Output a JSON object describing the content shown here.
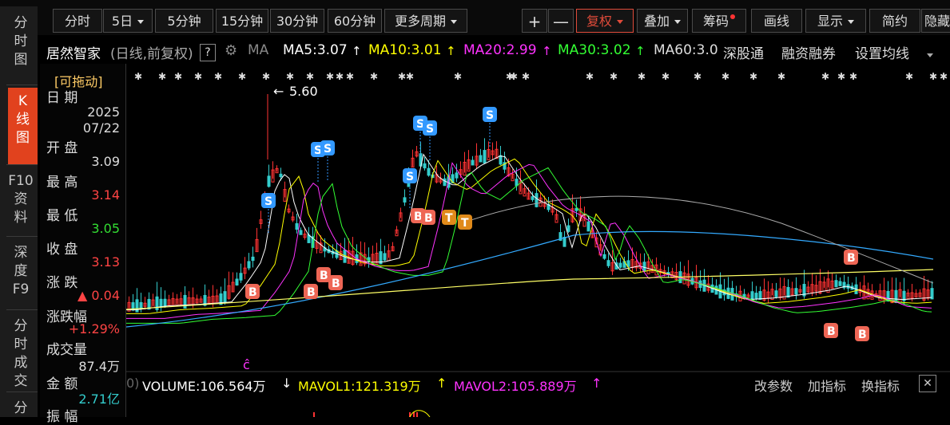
{
  "toolbar": {
    "buttons": [
      {
        "id": "fenshi",
        "label": "分时"
      },
      {
        "id": "5day",
        "label": "5日",
        "caret": true
      },
      {
        "id": "5min",
        "label": "5分钟"
      },
      {
        "id": "15min",
        "label": "15分钟"
      },
      {
        "id": "30min",
        "label": "30分钟"
      },
      {
        "id": "60min",
        "label": "60分钟"
      },
      {
        "id": "more",
        "label": "更多周期",
        "caret": true
      }
    ],
    "right_buttons": [
      {
        "id": "plus",
        "label": "+"
      },
      {
        "id": "minus",
        "label": "—"
      },
      {
        "id": "fuquan",
        "label": "复权",
        "caret": true,
        "active": true
      },
      {
        "id": "diejia",
        "label": "叠加",
        "caret": true
      },
      {
        "id": "chouma",
        "label": "筹码"
      },
      {
        "id": "huaxian",
        "label": "画线"
      },
      {
        "id": "xianshi",
        "label": "显示",
        "caret": true
      },
      {
        "id": "jianyue",
        "label": "简约"
      },
      {
        "id": "yincang",
        "label": "隐藏"
      }
    ]
  },
  "leftnav": [
    {
      "label": "分\n时\n图"
    },
    {
      "label": "K\n线\n图",
      "active": true
    },
    {
      "label": "F10\n资\n料"
    },
    {
      "label": "深\n度\nF9"
    },
    {
      "label": "分\n时\n成\n交"
    },
    {
      "label": "分"
    }
  ],
  "stock": {
    "name": "居然智家",
    "mode": "(日线,前复权)",
    "help": "?",
    "ma_label": "MA",
    "ma5": "MA5:3.07",
    "ma10": "MA10:3.01",
    "ma20": "MA20:2.99",
    "ma30": "MA30:3.02",
    "ma60": "MA60:3.0",
    "shengutong": "深股通",
    "rzrq": "融资融券",
    "setma": "设置均线"
  },
  "panel": {
    "drag": "[可拖动]",
    "date_label": "日 期",
    "year": "2025",
    "date": "07/22",
    "open_label": "开 盘",
    "open": "3.09",
    "high_label": "最 高",
    "high": "3.14",
    "low_label": "最 低",
    "low": "3.05",
    "close_label": "收 盘",
    "close": "3.13",
    "chg_label": "涨 跌",
    "chg": "▲ 0.04",
    "pct_label": "涨跌幅",
    "pct": "+1.29%",
    "vol_label": "成交量",
    "vol": "87.4万",
    "amt_label": "金 额",
    "amt": "2.71亿",
    "amp_label": "振 幅"
  },
  "chart": {
    "max_label": "5.60",
    "bottom_marker": "ĉ"
  },
  "volume": {
    "prefix": "0)",
    "volume": "VOLUME:106.564万",
    "mavol1": "MAVOL1:121.319万",
    "mavol2": "MAVOL2:105.889万",
    "edit": "改参数",
    "add": "加指标",
    "change": "换指标"
  },
  "chart_data": {
    "type": "line",
    "series": [
      {
        "name": "MA5",
        "color": "#ffffff"
      },
      {
        "name": "MA10",
        "color": "#ffff00"
      },
      {
        "name": "MA20",
        "color": "#ff33ff"
      },
      {
        "name": "MA30",
        "color": "#33ff33"
      },
      {
        "name": "MA60",
        "color": "#dddddd"
      }
    ],
    "signals": [
      "S",
      "S",
      "S",
      "S",
      "S",
      "S",
      "S",
      "S",
      "B",
      "B",
      "B",
      "B",
      "B",
      "B",
      "B",
      "B",
      "T",
      "T"
    ]
  },
  "colors": {
    "up": "#ff3333",
    "down": "#33cccc",
    "accent": "#e1421e"
  }
}
